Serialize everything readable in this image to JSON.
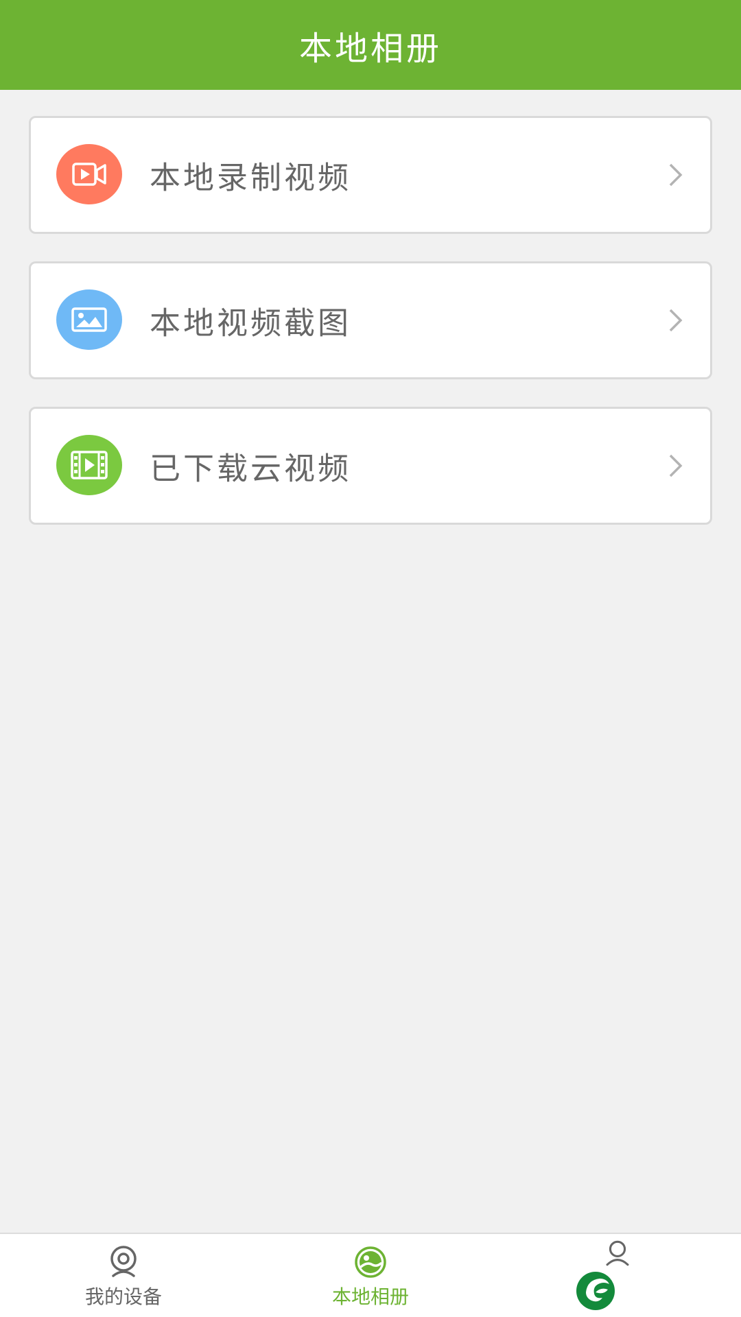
{
  "header": {
    "title": "本地相册"
  },
  "menu": [
    {
      "label": "本地录制视频",
      "icon": "video-camera-icon",
      "color": "#ff7a5f"
    },
    {
      "label": "本地视频截图",
      "icon": "image-icon",
      "color": "#6fb9f6"
    },
    {
      "label": "已下载云视频",
      "icon": "film-icon",
      "color": "#7bc940"
    }
  ],
  "tabbar": {
    "tabs": [
      {
        "label": "我的设备",
        "icon": "camera-device-icon",
        "active": false
      },
      {
        "label": "本地相册",
        "icon": "album-icon",
        "active": true
      },
      {
        "label": "",
        "icon": "user-icon",
        "active": false
      }
    ]
  },
  "colors": {
    "brand_green": "#6db333",
    "background": "#f1f1f1",
    "label_gray": "#666666",
    "logo_green": "#138a3b"
  }
}
